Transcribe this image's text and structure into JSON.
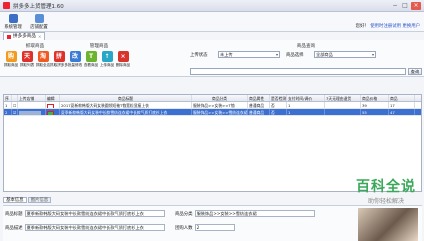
{
  "window": {
    "title": "拼多多上货管理1.60",
    "min": "−",
    "max": "□",
    "close": "×"
  },
  "menu": {
    "items": [
      {
        "label": "系统管理",
        "icon": "settings-icon",
        "color": "#3d6fc7"
      },
      {
        "label": "店铺配置",
        "icon": "store-icon",
        "color": "#5a8fd8"
      }
    ],
    "greeting": "您好！",
    "user_link": "使用时注册试用",
    "switch_link": "更换用户"
  },
  "tab": {
    "label": "拼多多商品",
    "close": "×"
  },
  "groups": {
    "fetch": {
      "label": "抓取商品",
      "tools": [
        {
          "label": "抓取商品",
          "icon": "cart-icon",
          "color": "#f29b20",
          "glyph": "购"
        },
        {
          "label": "抓取列表",
          "icon": "tmall-icon",
          "color": "#e0302a",
          "glyph": "天"
        },
        {
          "label": "抓取全店",
          "icon": "taobao-icon",
          "color": "#f15a22",
          "glyph": "淘"
        },
        {
          "label": "抓取拼多多",
          "icon": "pdd-icon",
          "color": "#e0302a",
          "glyph": "拼"
        }
      ]
    },
    "manage": {
      "label": "管理商品",
      "tools": [
        {
          "label": "批量修改",
          "icon": "edit-icon",
          "color": "#3a7bd5",
          "glyph": "改"
        },
        {
          "label": "查看商品",
          "icon": "view-icon",
          "color": "#6cb32e",
          "glyph": "T"
        },
        {
          "label": "上传商品",
          "icon": "upload-icon",
          "color": "#28a6c7",
          "glyph": "↑"
        },
        {
          "label": "删除商品",
          "icon": "delete-icon",
          "color": "#d9342b",
          "glyph": "×"
        }
      ]
    }
  },
  "query": {
    "label": "商品查询",
    "status_label": "上传状态",
    "status_value": "未上传",
    "choose_label": "商品选择",
    "choose_value": "全部商品",
    "search_btn": "查询"
  },
  "grid": {
    "headers": [
      "序",
      "上传店铺",
      "编辑",
      "商品标题",
      "商品分类",
      "商品属性",
      "是否检测",
      "支付时间/调价",
      "7天无理由退货",
      "商品价格",
      "商品"
    ],
    "rows": [
      {
        "no": "1",
        "title": "2017夏新款韩版大码女装圆领短袖T恤宽松显瘦上衣",
        "category": "服装饰品>>女装>>T恤",
        "attr": "普通商品",
        "check": "否",
        "pay": "1",
        "price": "39",
        "stock": "17"
      },
      {
        "no": "2",
        "title": "夏季新款韩版大码女装中长款雪纺连衣裙中长款气质打底衫上衣",
        "category": "服装饰品>>女装>>雪纺连衣裙",
        "attr": "普通商品",
        "check": "否",
        "pay": "1",
        "price": "55",
        "stock": "47"
      }
    ]
  },
  "bottomtabs": [
    "基本信息",
    "图片信息"
  ],
  "detail": {
    "title_label": "商品标题",
    "title_value": "夏季新款韩版大码女装中长款雪纺连衣裙中长款气质打底衫上衣",
    "cat_label": "商品分类",
    "cat_value": "服装饰品>>女装>>雪纺连衣裙",
    "desc_label": "商品描述",
    "desc_value": "夏季新款韩版大码女装中长款雪纺连衣裙中长款气质打底衫上衣",
    "group_label": "团购人数",
    "group_value": "2"
  },
  "watermark": {
    "big": "百科全说",
    "small": "助你轻松解决"
  }
}
